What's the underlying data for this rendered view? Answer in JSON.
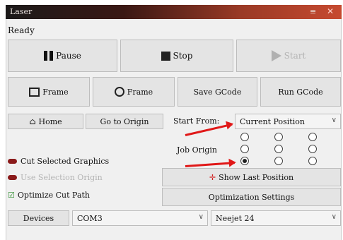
{
  "window": {
    "title": "Laser"
  },
  "status": "Ready",
  "controls": {
    "pause": "Pause",
    "stop": "Stop",
    "start": "Start",
    "frame1": "Frame",
    "frame2": "Frame",
    "save_gcode": "Save GCode",
    "run_gcode": "Run GCode",
    "home": "Home",
    "go_to_origin": "Go to Origin"
  },
  "start_from": {
    "label": "Start From:",
    "value": "Current Position"
  },
  "job_origin": {
    "label": "Job Origin",
    "selected": "bottom-left"
  },
  "options": {
    "cut_selected": "Cut Selected Graphics",
    "use_selection_origin": "Use Selection Origin",
    "optimize_cut_path": "Optimize Cut Path"
  },
  "buttons": {
    "show_last_position": "Show Last Position",
    "optimization_settings": "Optimization Settings"
  },
  "devices": {
    "label": "Devices",
    "port": "COM3",
    "machine": "Neejet 24"
  }
}
